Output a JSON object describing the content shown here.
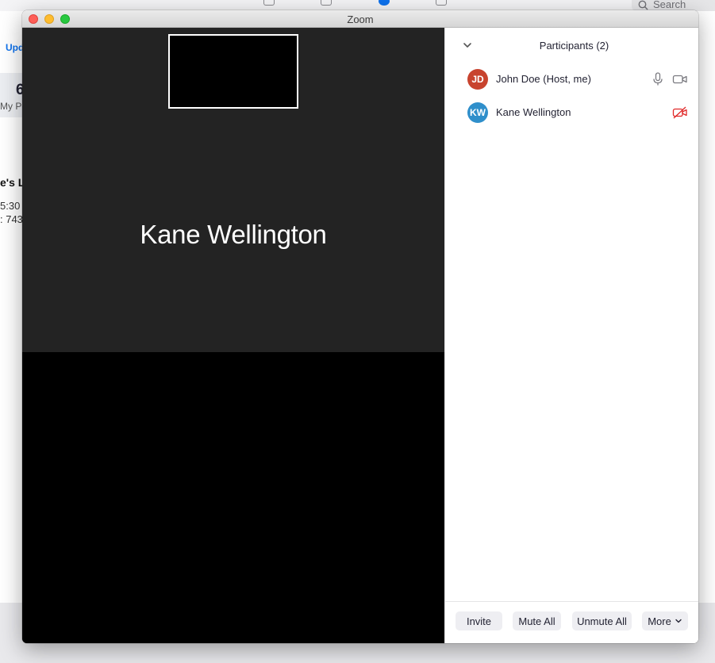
{
  "background_app": {
    "search_placeholder": "Search",
    "update_link": "Upd",
    "stat_number": "6",
    "stat_label": "My Pe",
    "meeting_title": "e's L",
    "meeting_time": "5:30",
    "meeting_id": ": 743"
  },
  "window": {
    "title": "Zoom"
  },
  "video": {
    "active_speaker_name": "Kane Wellington"
  },
  "participants_panel": {
    "title": "Participants (2)",
    "participants": [
      {
        "initials": "JD",
        "name": "John Doe (Host, me)",
        "avatar_color": "#c8432e",
        "mic": "on",
        "video": "on"
      },
      {
        "initials": "KW",
        "name": "Kane Wellington",
        "avatar_color": "#2f8fcb",
        "mic": "none",
        "video": "off"
      }
    ],
    "buttons": {
      "invite": "Invite",
      "mute_all": "Mute All",
      "unmute_all": "Unmute All",
      "more": "More"
    }
  },
  "colors": {
    "accent": "#0e72ed",
    "video_off_red": "#e02828",
    "dark_tile": "#232323"
  }
}
